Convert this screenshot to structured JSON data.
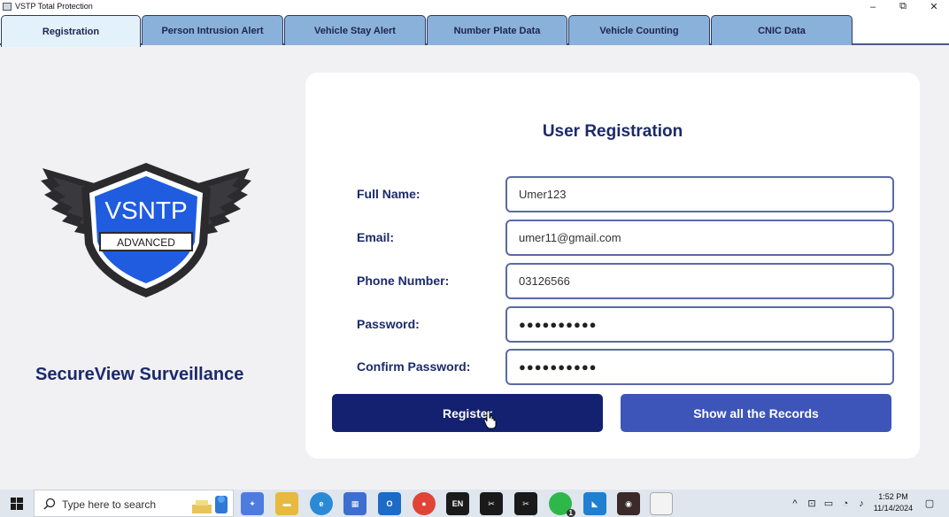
{
  "window": {
    "title": "VSTP Total Protection",
    "minimize_glyph": "–",
    "maximize_glyph": "⧉",
    "close_glyph": "✕"
  },
  "tabs": [
    {
      "label": "Registration",
      "active": true
    },
    {
      "label": "Person Intrusion Alert",
      "active": false
    },
    {
      "label": "Vehicle Stay Alert",
      "active": false
    },
    {
      "label": "Number Plate Data",
      "active": false
    },
    {
      "label": "Vehicle Counting",
      "active": false
    },
    {
      "label": "CNIC Data",
      "active": false
    }
  ],
  "brand": {
    "logo_text": "VSNTP",
    "logo_subtext": "ADVANCED",
    "name": "SecureView Surveillance",
    "colors": {
      "shield_blue": "#1f5ce0",
      "shield_dark": "#2b2b2e",
      "navy": "#1b2a6b"
    }
  },
  "form": {
    "title": "User Registration",
    "fields": [
      {
        "label": "Full Name:",
        "value": "Umer123"
      },
      {
        "label": "Email:",
        "value": "umer11@gmail.com"
      },
      {
        "label": "Phone Number:",
        "value": "03126566"
      },
      {
        "label": "Password:",
        "value": "●●●●●●●●●●"
      },
      {
        "label": "Confirm Password:",
        "value": "●●●●●●●●●●"
      }
    ],
    "register_label": "Register",
    "show_records_label": "Show all the Records"
  },
  "taskbar": {
    "search_placeholder": "Type here to search",
    "apps": [
      {
        "icon": "copilot-icon"
      },
      {
        "icon": "file-explorer-icon"
      },
      {
        "icon": "edge-icon"
      },
      {
        "icon": "store-icon"
      },
      {
        "icon": "outlook-icon"
      },
      {
        "icon": "chrome-icon"
      },
      {
        "icon": "en-app-icon",
        "text": "EN"
      },
      {
        "icon": "capcut-icon"
      },
      {
        "icon": "capcut-alt-icon"
      },
      {
        "icon": "whatsapp-icon",
        "badge": "1"
      },
      {
        "icon": "vscode-icon"
      },
      {
        "icon": "recorder-icon"
      },
      {
        "icon": "document-icon"
      }
    ],
    "time": "1:52 PM",
    "date": "11/14/2024"
  }
}
